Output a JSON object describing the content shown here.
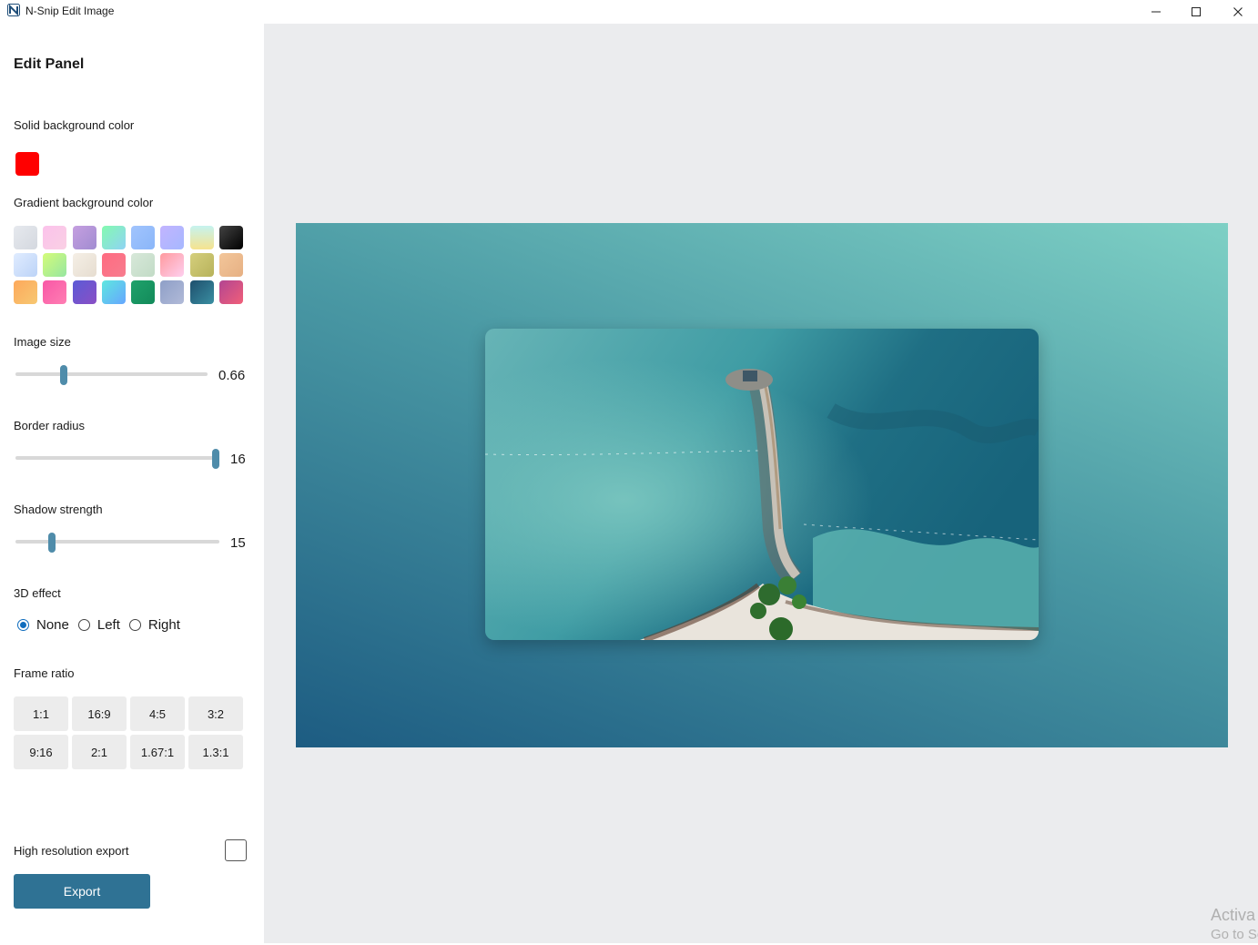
{
  "window": {
    "title": "N-Snip Edit Image",
    "app_icon": "n-snip-logo-icon"
  },
  "panel": {
    "title": "Edit Panel",
    "solid_bg": {
      "label": "Solid background color",
      "color": "#ff0000"
    },
    "gradient_bg": {
      "label": "Gradient background color",
      "swatches": [
        "linear-gradient(135deg,#e6e9ee,#d4d8df)",
        "linear-gradient(135deg,#fbc2eb,#fad0e4)",
        "linear-gradient(135deg,#c59fe0,#a18cd1)",
        "linear-gradient(135deg,#84fab0,#8fd3f4)",
        "linear-gradient(135deg,#a1c4fd,#8ab6f9)",
        "linear-gradient(135deg,#c2b4ff,#a6b8ff)",
        "linear-gradient(180deg,#c6f3ef,#f6e38e)",
        "linear-gradient(135deg,#434343,#000000)",
        "linear-gradient(135deg,#e0ecff,#bcd3f7)",
        "linear-gradient(135deg,#d4fc79,#96e6a1)",
        "linear-gradient(135deg,#f5efe6,#e6ddd0)",
        "linear-gradient(135deg,#ff6b81,#f77c8e)",
        "linear-gradient(135deg,#d7e8d9,#c2dbc6)",
        "linear-gradient(135deg,#ff9a9e,#fecfef)",
        "linear-gradient(135deg,#d5cf7d,#b7b25a)",
        "linear-gradient(135deg,#f3c69a,#e6b083)",
        "linear-gradient(135deg,#fda85b,#f7c872)",
        "linear-gradient(135deg,#f857a6,#ff7eb3)",
        "linear-gradient(135deg,#5b5bd6,#8a4fc5)",
        "linear-gradient(135deg,#5ee7df,#66a6ff)",
        "linear-gradient(135deg,#1fa26b,#138a5a)",
        "linear-gradient(135deg,#8e9fc7,#b1bad8)",
        "linear-gradient(135deg,#1e4f6d,#3a8fa2)",
        "linear-gradient(135deg,#b24592,#f15f79)"
      ]
    },
    "image_size": {
      "label": "Image size",
      "value": "0.66",
      "fraction": 0.25
    },
    "border_radius": {
      "label": "Border radius",
      "value": "16",
      "fraction": 1.0
    },
    "shadow_strength": {
      "label": "Shadow strength",
      "value": "15",
      "fraction": 0.18
    },
    "effect_3d": {
      "label": "3D effect",
      "options": [
        {
          "label": "None",
          "checked": true
        },
        {
          "label": "Left",
          "checked": false
        },
        {
          "label": "Right",
          "checked": false
        }
      ]
    },
    "frame_ratio": {
      "label": "Frame ratio",
      "options": [
        "1:1",
        "16:9",
        "4:5",
        "3:2",
        "9:16",
        "2:1",
        "1.67:1",
        "1.3:1"
      ]
    },
    "hires_export": {
      "label": "High resolution export",
      "checked": false
    },
    "export_label": "Export"
  },
  "canvas": {
    "photo_subject": "aerial-pier-photo",
    "watermark_line1": "Activa",
    "watermark_line2": "Go to Se"
  }
}
